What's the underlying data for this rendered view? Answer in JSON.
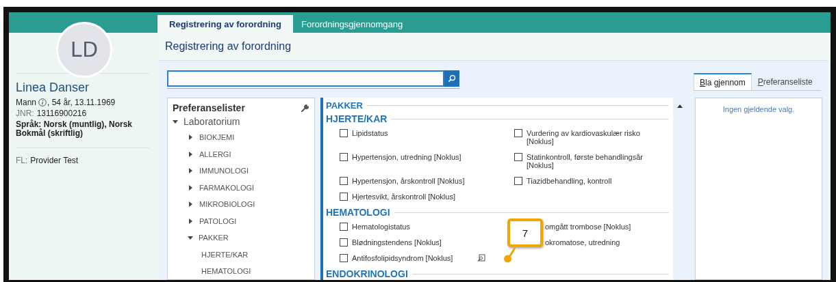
{
  "header_tabs": [
    {
      "label": "Registrering av forordning",
      "selected": true
    },
    {
      "label": "Forordningsgjennomgang",
      "selected": false
    }
  ],
  "patient": {
    "initials": "LD",
    "name": "Linea Danser",
    "gender": "Mann",
    "demographics": ", 54 år, 13.11.1969",
    "jnr_label": "JNR:",
    "jnr": "13116900216",
    "language": "Språk: Norsk (muntlig), Norsk Bokmål (skriftlig)",
    "fl_label": "FL:",
    "fl": "Provider Test"
  },
  "page_title": "Registrering av forordning",
  "preference_lists": {
    "title": "Preferanselister",
    "tree": [
      {
        "label": "Laboratorium",
        "expanded": true,
        "children": [
          {
            "label": "BIOKJEMI",
            "expanded": false
          },
          {
            "label": "ALLERGI",
            "expanded": false
          },
          {
            "label": "IMMUNOLOGI",
            "expanded": false
          },
          {
            "label": "FARMAKOLOGI",
            "expanded": false
          },
          {
            "label": "MIKROBIOLOGI",
            "expanded": false
          },
          {
            "label": "PATOLOGI",
            "expanded": false
          },
          {
            "label": "PAKKER",
            "expanded": true,
            "children": [
              {
                "label": "HJERTE/KAR"
              },
              {
                "label": "HEMATOLOGI"
              }
            ]
          }
        ]
      }
    ]
  },
  "catalog": {
    "heading": "PAKKER",
    "groups": [
      {
        "title": "HJERTE/KAR",
        "items": [
          {
            "label": "Lipidstatus",
            "checked": false
          },
          {
            "label": "Vurdering av kardiovaskulær risko [Noklus]",
            "checked": false
          },
          {
            "label": "Hypertensjon, utredning [Noklus]",
            "checked": false
          },
          {
            "label": "Statinkontroll, første behandlingsår [Noklus]",
            "checked": false
          },
          {
            "label": "Hypertensjon, årskontroll [Noklus]",
            "checked": false
          },
          {
            "label": "Tiazidbehandling, kontroll",
            "checked": false
          },
          {
            "label": "Hjertesvikt, årskontroll [Noklus]",
            "checked": false
          }
        ]
      },
      {
        "title": "HEMATOLOGI",
        "items": [
          {
            "label": "Hematologistatus",
            "checked": false
          },
          {
            "label": "omgått trombose [Noklus]",
            "obscured": true
          },
          {
            "label": "Blødningstendens [Noklus]",
            "checked": false
          },
          {
            "label": "okromatose, utredning",
            "obscured": true
          },
          {
            "label": "Antifosfolipidsyndrom [Noklus]",
            "checked": false,
            "preview": true
          }
        ]
      },
      {
        "title": "ENDOKRINOLOGI"
      }
    ]
  },
  "side_tabs": [
    {
      "label": "Bla gjennom",
      "selected": true
    },
    {
      "label": "Preferanseliste",
      "selected": false
    }
  ],
  "browse_message": "Ingen gjeldende valg.",
  "callout": {
    "label": "7"
  }
}
